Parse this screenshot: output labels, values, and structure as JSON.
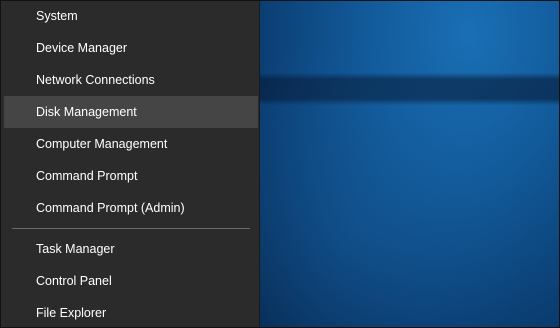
{
  "menu": {
    "group1": [
      {
        "label": "System"
      },
      {
        "label": "Device Manager"
      },
      {
        "label": "Network Connections"
      },
      {
        "label": "Disk Management"
      },
      {
        "label": "Computer Management"
      },
      {
        "label": "Command Prompt"
      },
      {
        "label": "Command Prompt (Admin)"
      }
    ],
    "group2": [
      {
        "label": "Task Manager"
      },
      {
        "label": "Control Panel"
      },
      {
        "label": "File Explorer"
      }
    ],
    "highlighted": "Disk Management"
  },
  "colors": {
    "menu_bg": "#2b2b2b",
    "hover_bg": "#454545",
    "text": "#ffffff",
    "separator": "#6b6b6b",
    "desktop": "#125a9a"
  }
}
